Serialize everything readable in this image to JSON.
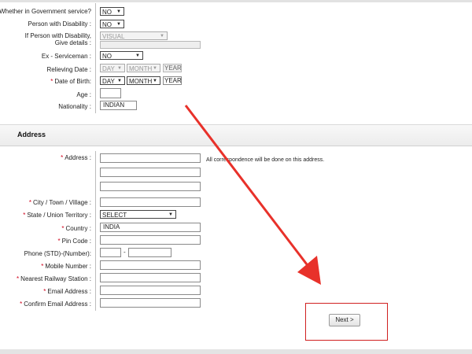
{
  "personal": {
    "govt_service": {
      "label": "Whether in Government service?",
      "value": "NO"
    },
    "disability": {
      "label": "Person with Disability :",
      "value": "NO"
    },
    "disability_details": {
      "label_line1": "If Person with Disability,",
      "label_line2": "Give details :",
      "value": "VISUAL"
    },
    "ex_serviceman": {
      "label": "Ex - Serviceman :",
      "value": "NO"
    },
    "relieving_date": {
      "label": "Relieving Date :",
      "day": "DAY",
      "month": "MONTH",
      "year": "YEAR"
    },
    "dob": {
      "label": "Date of Birth:",
      "day": "DAY",
      "month": "MONTH",
      "year": "YEAR"
    },
    "age": {
      "label": "Age :",
      "value": ""
    },
    "nationality": {
      "label": "Nationality :",
      "value": "INDIAN"
    }
  },
  "address_section": {
    "title": "Address",
    "address": {
      "label": "Address :",
      "note": "All correspondence will be done on this address."
    },
    "city": {
      "label": "City / Town / Village :"
    },
    "state": {
      "label": "State / Union Territory :",
      "value": "SELECT"
    },
    "country": {
      "label": "Country :",
      "value": "INDIA"
    },
    "pin": {
      "label": "Pin Code :"
    },
    "phone": {
      "label": "Phone (STD)-(Number):",
      "separator": "-"
    },
    "mobile": {
      "label": "Mobile Number :"
    },
    "railway": {
      "label": "Nearest Railway Station :"
    },
    "email": {
      "label": "Email Address :"
    },
    "confirm_email": {
      "label": "Confirm Email Address :"
    }
  },
  "actions": {
    "next_label": "Next >"
  },
  "colors": {
    "annotation_red": "#e8312a",
    "required_star": "#d0021b"
  },
  "icons": {
    "dropdown": "chevron-down-icon",
    "annotation": "red-arrow-annotation"
  }
}
